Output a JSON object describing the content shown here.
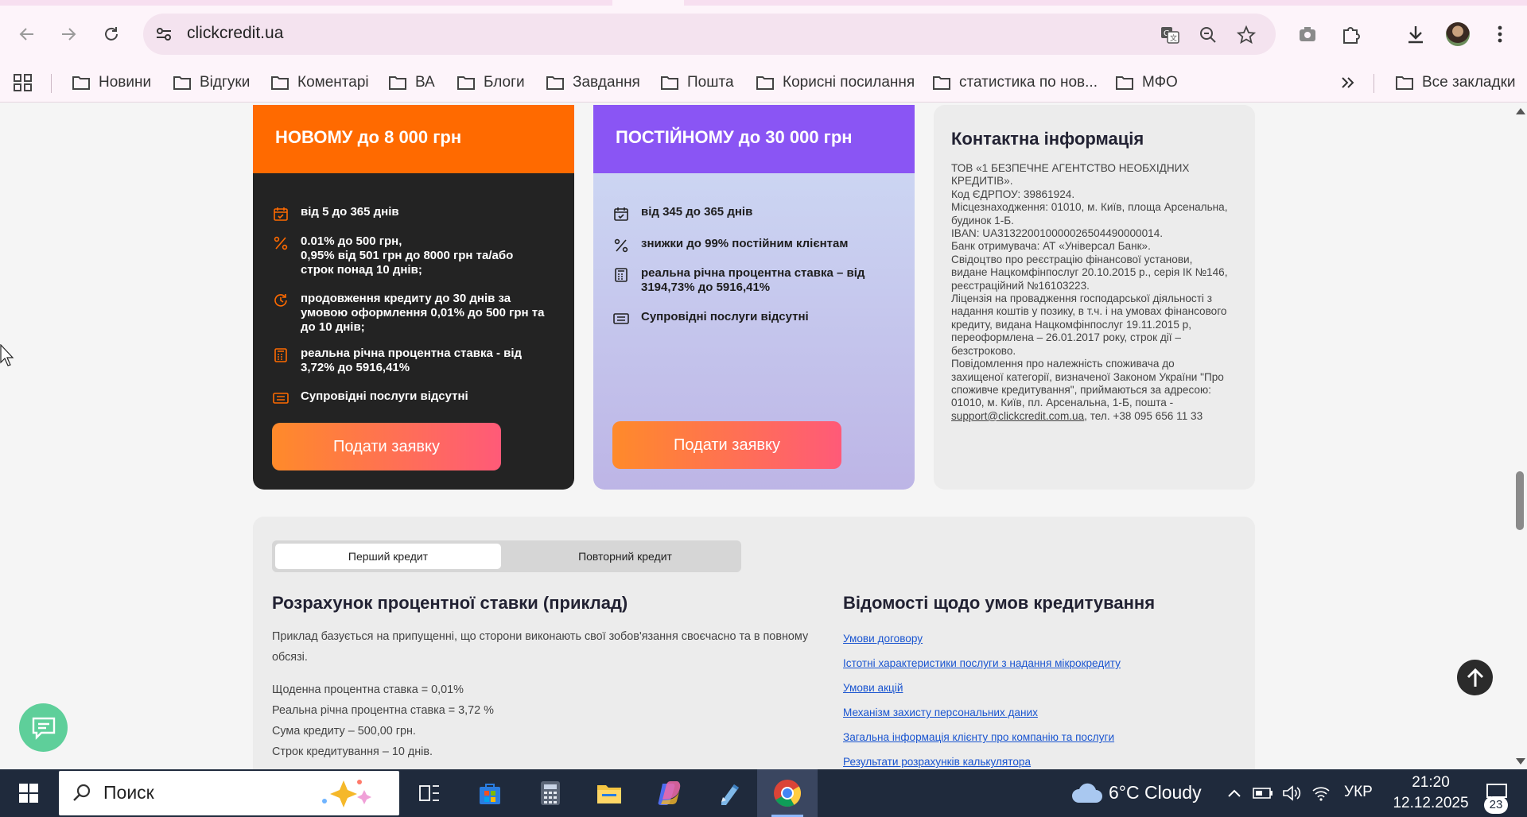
{
  "browser": {
    "url": "clickcredit.ua",
    "bookmarks": [
      "Новини",
      "Відгуки",
      "Коментарі",
      "ВА",
      "Блоги",
      "Завдання",
      "Пошта",
      "Корисні посилання",
      "статистика по нов...",
      "МФО"
    ],
    "all_bookmarks_label": "Все закладки"
  },
  "card_new": {
    "title": "НОВОМУ до 8 000 грн",
    "features": [
      {
        "icon": "calendar-icon",
        "lines": [
          "від 5 до 365 днів"
        ]
      },
      {
        "icon": "percent-icon",
        "lines": [
          "0.01% до 500 грн,",
          "0,95% від 501 грн до 8000 грн та/або",
          "строк понад 10 днів;"
        ]
      },
      {
        "icon": "refresh-icon",
        "lines": [
          "продовження кредиту до 30 днів за",
          "умовою оформлення 0,01% до 500 грн та",
          "до 10 днів;"
        ]
      },
      {
        "icon": "calculator-icon",
        "lines": [
          "реальна річна процентна ставка - від",
          "3,72% до 5916,41%"
        ]
      },
      {
        "icon": "document-icon",
        "lines": [
          "Супровідні послуги відсутні"
        ]
      }
    ],
    "button": "Подати заявку"
  },
  "card_regular": {
    "title": "ПОСТІЙНОМУ до 30 000 грн",
    "features": [
      {
        "icon": "calendar-icon",
        "lines": [
          "від 345 до 365 днів"
        ]
      },
      {
        "icon": "percent-icon",
        "lines": [
          "знижки до 99% постійним клієнтам"
        ]
      },
      {
        "icon": "calculator-icon",
        "lines": [
          "реальна річна процентна ставка – від",
          "3194,73% до 5916,41%"
        ]
      },
      {
        "icon": "document-icon",
        "lines": [
          "Супровідні послуги відсутні"
        ]
      }
    ],
    "button": "Подати заявку"
  },
  "contact": {
    "title": "Контактна інформація",
    "lines": [
      "ТОВ «1 БЕЗПЕЧНЕ АГЕНТСТВО НЕОБХІДНИХ",
      "КРЕДИТІВ».",
      "Код ЄДРПОУ: 39861924.",
      "Місцезнаходження: 01010, м. Київ, площа Арсенальна,",
      "будинок 1-Б.",
      "IBAN: UA313220010000026504490000014.",
      "Банк отримувача: АТ «Універсал Банк».",
      "Свідоцтво про реєстрацію фінансової установи,",
      "видане Нацкомфінпослуг 20.10.2015 р., серія ІК №146,",
      "реєстраційний №16103223.",
      "Ліцензія на провадження господарської діяльності з",
      "надання коштів у позику, в т.ч. і на умовах фінансового",
      "кредиту, видана Нацкомфінпослуг 19.11.2015 р,",
      "переоформлена – 26.01.2017 року, строк дії –",
      "безстроково.",
      "Повідомлення про належність споживача до",
      "захищеної категорії, визначеної Законом України \"Про",
      "споживче кредитування\", приймаються за адресою:",
      "01010, м. Київ, пл. Арсенальна, 1-Б, пошта -"
    ],
    "email": "support@clickcredit.com.ua",
    "phone_suffix": ", тел. +38 095 656 11 33"
  },
  "calc": {
    "tab_first": "Перший кредит",
    "tab_repeat": "Повторний кредит",
    "title": "Розрахунок процентної ставки (приклад)",
    "desc_lines": [
      "Приклад базується на припущенні, що сторони виконають свої зобов'язання своєчасно та в повному",
      "обсязі."
    ],
    "rows": [
      "Щоденна процентна ставка = 0,01%",
      "Реальна річна процентна ставка = 3,72 %",
      "Сума кредиту – 500,00 грн.",
      "Строк кредитування – 10 днів."
    ],
    "info_title": "Відомості щодо умов кредитування",
    "links": [
      "Умови договору",
      "Істотні характеристики послуги з надання мікрокредиту",
      "Умови акцій",
      "Механізм захисту персональних даних",
      "Загальна інформація клієнту про компанію та послуги",
      "Результати розрахунків калькулятора"
    ]
  },
  "taskbar": {
    "search_label": "Поиск",
    "weather": "6°C  Cloudy",
    "lang": "УКР",
    "time": "21:20",
    "date": "12.12.2025",
    "notifications": "23"
  },
  "colors": {
    "new_header": "#ff6a00",
    "regular_header": "#8a55f4",
    "accent_gradient_start": "#ff8a2a",
    "accent_gradient_end": "#ff5a78",
    "chat": "#5ecf9a"
  }
}
